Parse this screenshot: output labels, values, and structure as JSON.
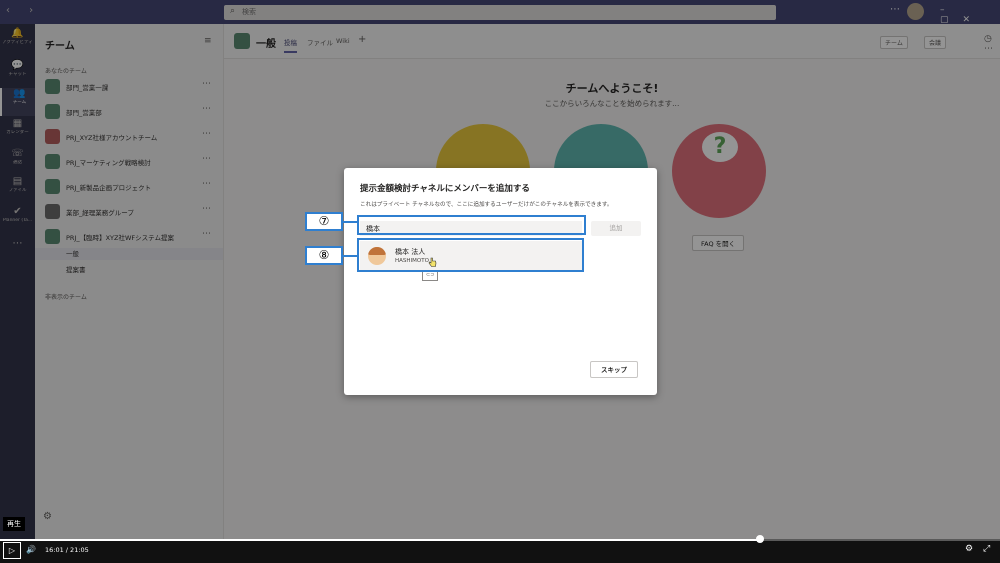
{
  "search": {
    "placeholder": "検索"
  },
  "rail": [
    {
      "icon": "bell-icon",
      "glyph": "🔔",
      "label": "アクティビティ"
    },
    {
      "icon": "chat-icon",
      "glyph": "💬",
      "label": "チャット"
    },
    {
      "icon": "teams-icon",
      "glyph": "👥",
      "label": "チーム"
    },
    {
      "icon": "calendar-icon",
      "glyph": "▦",
      "label": "カレンダー"
    },
    {
      "icon": "phone-icon",
      "glyph": "☏",
      "label": "通話"
    },
    {
      "icon": "files-icon",
      "glyph": "▤",
      "label": "ファイル"
    },
    {
      "icon": "planner-icon",
      "glyph": "✔",
      "label": "Planner (Ta..."
    },
    {
      "icon": "more-apps-icon",
      "glyph": "⋯",
      "label": ""
    }
  ],
  "panel": {
    "title": "チーム",
    "section_mine": "あなたのチーム",
    "section_hidden": "非表示のチーム",
    "teams": [
      {
        "name": "部門_営業一課",
        "color": "#5b8a72"
      },
      {
        "name": "部門_営業部",
        "color": "#5b8a72"
      },
      {
        "name": "PRJ_XYZ社様アカウントチーム",
        "color": "#b45d5d"
      },
      {
        "name": "PRJ_マーケティング戦略検討",
        "color": "#5b8a72"
      },
      {
        "name": "PRJ_新製品企画プロジェクト",
        "color": "#5b8a72"
      },
      {
        "name": "業部_経理業務グループ",
        "color": "#6b6b6b"
      },
      {
        "name": "PRJ_【臨時】XYZ社WFシステム提案",
        "color": "#5b8a72"
      }
    ],
    "channels": [
      "一般",
      "提案書"
    ]
  },
  "main": {
    "channel_title": "一般",
    "tabs": [
      "投稿",
      "ファイル",
      "Wiki"
    ],
    "team_button": "チーム",
    "meet_button": "会議",
    "welcome_title": "チームへようこそ!",
    "welcome_sub": "ここからいろんなことを始められます...",
    "faq_button": "FAQ を開く"
  },
  "dialog": {
    "title": "提示金額検討チャネルにメンバーを追加する",
    "description": "これはプライベート チャネルなので、ここに追加するユーザーだけがこのチャネルを表示できます。",
    "input_value": "橋本",
    "add_button": "追加",
    "suggestion_name": "橋本 法人",
    "suggestion_id": "HASHIMOTO",
    "skip_button": "スキップ"
  },
  "callouts": {
    "step7": "⑦",
    "step8": "⑧"
  },
  "video": {
    "play_tooltip": "再生",
    "time": "16:01 / 21:05",
    "progress": 0.76
  },
  "colors": {
    "accent": "#6264a7",
    "callout": "#2f7fd0",
    "titlebar": "#464775"
  }
}
